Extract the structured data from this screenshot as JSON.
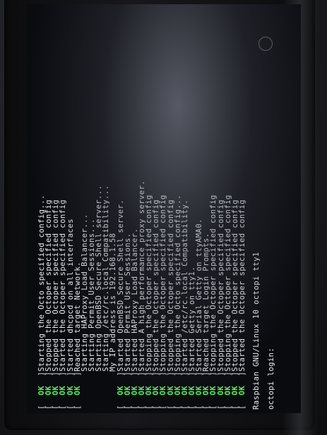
{
  "terminal": {
    "boot_lines": [
      {
        "status": "OK",
        "text": "Starting the Octo specified config..."
      },
      {
        "status": "OK",
        "text": "Stopped the Octoper specified config"
      },
      {
        "status": "OK",
        "text": "Stopped the Octoper specified config"
      },
      {
        "status": "OK",
        "text": "Started the Octoper specified config"
      },
      {
        "status": "OK",
        "text": "Started dhcpcd on all interfaces"
      },
      {
        "status": "OK",
        "text": "Reached target Network."
      },
      {
        "status": "",
        "text": "Starting HAProxy Load Balancer..."
      },
      {
        "status": "",
        "text": "Starting Permit User Sessions..."
      },
      {
        "status": "",
        "text": "Starting OpenBSD Secure Shell server..."
      },
      {
        "status": "",
        "text": "Starting /etc/rc.local Compatibility..."
      },
      {
        "status": "",
        "text": "My IP address is 192.168.1.58"
      },
      {
        "status": "OK",
        "text": "Started OpenBSD Secure Shell server."
      },
      {
        "status": "OK",
        "text": "Started Permit User Sessions."
      },
      {
        "status": "OK",
        "text": "Started HAProxy Load Balancer."
      },
      {
        "status": "OK",
        "text": "Started A high performance proxy server."
      },
      {
        "status": "OK",
        "text": "Stopping the Octoper specified config"
      },
      {
        "status": "OK",
        "text": "Stopped the Octoper specified config"
      },
      {
        "status": "OK",
        "text": "Stopping the Octoper specified config"
      },
      {
        "status": "OK",
        "text": "Stopped the Octoper specified config"
      },
      {
        "status": "OK",
        "text": "Stopping the Octo specified config..."
      },
      {
        "status": "OK",
        "text": "Started /etc/rc.local Compatibility."
      },
      {
        "status": "OK",
        "text": "Started Getty on tty1."
      },
      {
        "status": "OK",
        "text": "Started Serial Getty on ttyAMA0."
      },
      {
        "status": "OK",
        "text": "Reached target Login Prompts."
      },
      {
        "status": "OK",
        "text": "Stopping the Octoper specified config"
      },
      {
        "status": "OK",
        "text": "Stopped the Octoper specified config"
      },
      {
        "status": "OK",
        "text": "Stopping the Octoper specified config"
      },
      {
        "status": "OK",
        "text": "Stopped the Octoper specified config"
      },
      {
        "status": "OK",
        "text": "Started the Octoper specified config"
      }
    ],
    "banner": "Raspbian GNU/Linux 10 octopi tty1",
    "prompt": "octopi login:"
  }
}
